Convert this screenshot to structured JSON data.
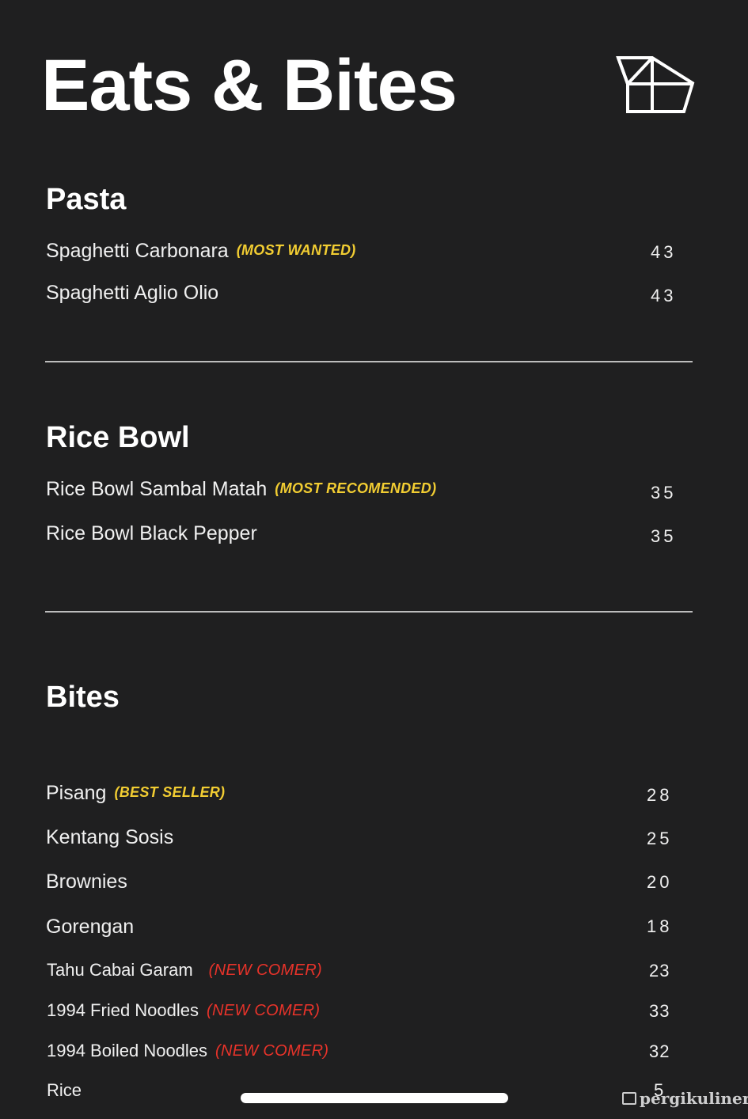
{
  "title": "Eats & Bites",
  "logo_icon": "house-pentagon-logo-icon",
  "sections": [
    {
      "title": "Pasta",
      "items": [
        {
          "name": "Spaghetti Carbonara",
          "tag": "(MOST WANTED)",
          "tag_color": "#f2cd32",
          "price": "43"
        },
        {
          "name": "Spaghetti Aglio Olio",
          "tag": "",
          "price": "43"
        }
      ]
    },
    {
      "title": "Rice Bowl",
      "items": [
        {
          "name": "Rice Bowl Sambal Matah",
          "tag": "(MOST RECOMENDED)",
          "tag_color": "#f2cd32",
          "price": "35"
        },
        {
          "name": "Rice Bowl Black Pepper",
          "tag": "",
          "price": "35"
        }
      ]
    },
    {
      "title": "Bites",
      "items": [
        {
          "name": "Pisang",
          "tag": "(BEST SELLER)",
          "tag_color": "#f2cd32",
          "price": "28"
        },
        {
          "name": "Kentang Sosis",
          "tag": "",
          "price": "25"
        },
        {
          "name": "Brownies",
          "tag": "",
          "price": "20"
        },
        {
          "name": "Gorengan",
          "tag": "",
          "price": "18"
        },
        {
          "name": "Tahu Cabai Garam",
          "tag": "(NEW COMER)",
          "tag_color": "#e8332a",
          "price": "23"
        },
        {
          "name": "1994 Fried Noodles",
          "tag": "(NEW COMER)",
          "tag_color": "#e8332a",
          "price": "33"
        },
        {
          "name": "1994 Boiled Noodles",
          "tag": "(NEW COMER)",
          "tag_color": "#e8332a",
          "price": "32"
        },
        {
          "name": "Rice",
          "tag": "",
          "price": "5"
        }
      ]
    }
  ],
  "watermark": "pergikuliner",
  "colors": {
    "background": "#1f1f20",
    "highlight_yellow": "#f2cd32",
    "highlight_red": "#e8332a",
    "text": "#ffffff"
  }
}
